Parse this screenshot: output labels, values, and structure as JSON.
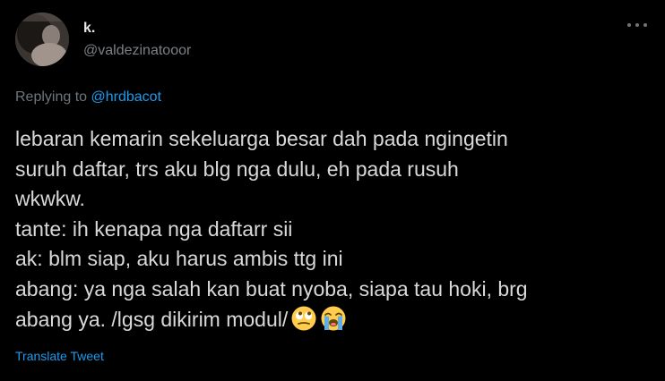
{
  "author": {
    "display_name": "k.",
    "handle": "@valdezinatooor"
  },
  "reply": {
    "prefix": "Replying to ",
    "mention": "@hrdbacot"
  },
  "tweet": {
    "lines": [
      "lebaran kemarin sekeluarga besar dah pada ngingetin",
      "suruh daftar, trs aku blg nga dulu, eh pada rusuh",
      "wkwkw.",
      "tante: ih kenapa nga daftarr sii",
      "ak: blm siap, aku harus ambis ttg ini",
      "abang: ya nga salah kan buat nyoba, siapa tau hoki, brg",
      "abang ya. /lgsg dikirim modul/"
    ],
    "emojis": [
      "face-with-rolling-eyes-icon",
      "loudly-crying-face-icon"
    ]
  },
  "actions": {
    "translate_label": "Translate Tweet",
    "more_icon": "more-options-icon"
  },
  "colors": {
    "background": "#000000",
    "text": "#d9d9d9",
    "muted": "#6e767d",
    "link": "#1d9bf0"
  }
}
